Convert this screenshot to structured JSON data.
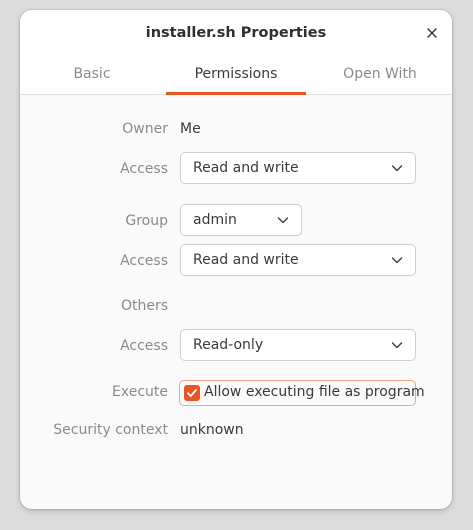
{
  "window": {
    "title": "installer.sh Properties"
  },
  "tabs": [
    {
      "label": "Basic"
    },
    {
      "label": "Permissions"
    },
    {
      "label": "Open With"
    }
  ],
  "permissions": {
    "owner_label": "Owner",
    "owner_value": "Me",
    "owner_access_label": "Access",
    "owner_access_value": "Read and write",
    "group_label": "Group",
    "group_value": "admin",
    "group_access_label": "Access",
    "group_access_value": "Read and write",
    "others_label": "Others",
    "others_access_label": "Access",
    "others_access_value": "Read-only",
    "execute_label": "Execute",
    "execute_checkbox_label": "Allow executing file as program",
    "execute_checked": true,
    "security_label": "Security context",
    "security_value": "unknown"
  },
  "colors": {
    "accent": "#e95420"
  },
  "icons": {
    "close": "close-icon",
    "chevron": "chevron-down-icon",
    "check": "check-icon"
  }
}
